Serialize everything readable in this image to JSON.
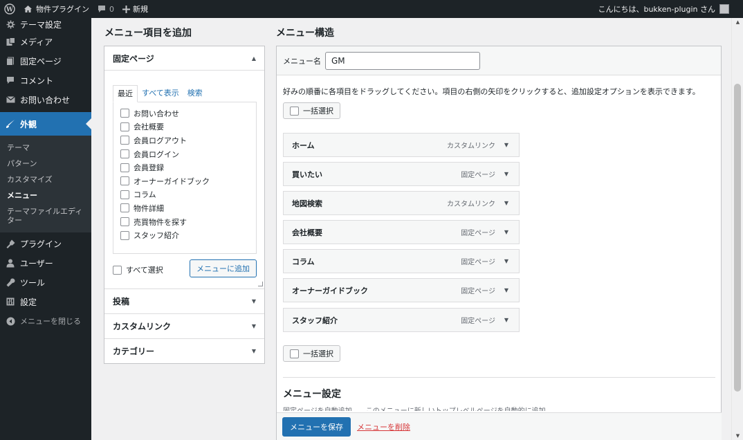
{
  "adminbar": {
    "site_name": "物件プラグイン",
    "comments_count": "0",
    "new_label": "新規",
    "greeting": "こんにちは、bukken-plugin さん"
  },
  "sidebar": {
    "items_top": [
      {
        "label": "テーマ設定",
        "icon": "brush-icon"
      },
      {
        "label": "メディア",
        "icon": "media-icon"
      },
      {
        "label": "固定ページ",
        "icon": "page-icon"
      },
      {
        "label": "コメント",
        "icon": "comment-icon"
      },
      {
        "label": "お問い合わせ",
        "icon": "mail-icon"
      }
    ],
    "current": {
      "label": "外観",
      "icon": "appearance-icon"
    },
    "submenu": [
      "テーマ",
      "パターン",
      "カスタマイズ",
      "メニュー",
      "テーマファイルエディター"
    ],
    "submenu_current": "メニュー",
    "items_bottom": [
      {
        "label": "プラグイン",
        "icon": "plugin-icon"
      },
      {
        "label": "ユーザー",
        "icon": "user-icon"
      },
      {
        "label": "ツール",
        "icon": "tools-icon"
      },
      {
        "label": "設定",
        "icon": "settings-icon"
      }
    ],
    "collapse_label": "メニューを閉じる"
  },
  "add_items": {
    "heading": "メニュー項目を追加",
    "pages_section": {
      "title": "固定ページ",
      "tabs": [
        "最近",
        "すべて表示",
        "検索"
      ],
      "active_tab": "最近",
      "pages": [
        "お問い合わせ",
        "会社概要",
        "会員ログアウト",
        "会員ログイン",
        "会員登録",
        "オーナーガイドブック",
        "コラム",
        "物件詳細",
        "売買物件を探す",
        "スタッフ紹介"
      ],
      "select_all_label": "すべて選択",
      "add_button": "メニューに追加"
    },
    "other_sections": [
      "投稿",
      "カスタムリンク",
      "カテゴリー"
    ]
  },
  "menu_structure": {
    "heading": "メニュー構造",
    "name_label": "メニュー名",
    "name_value": "GM",
    "instructions": "好みの順番に各項目をドラッグしてください。項目の右側の矢印をクリックすると、追加設定オプションを表示できます。",
    "bulk_select_label": "一括選択",
    "items": [
      {
        "title": "ホーム",
        "type": "カスタムリンク"
      },
      {
        "title": "買いたい",
        "type": "固定ページ"
      },
      {
        "title": "地図検索",
        "type": "カスタムリンク"
      },
      {
        "title": "会社概要",
        "type": "固定ページ"
      },
      {
        "title": "コラム",
        "type": "固定ページ"
      },
      {
        "title": "オーナーガイドブック",
        "type": "固定ページ"
      },
      {
        "title": "スタッフ紹介",
        "type": "固定ページ"
      }
    ],
    "settings_heading": "メニュー設定",
    "settings_partial": "固定ページを自動追加　　このメニューに新しいトップレベルページを自動的に追加",
    "save_button": "メニューを保存",
    "delete_link": "メニューを削除"
  },
  "colors": {
    "accent": "#2271b1",
    "sidebar_bg": "#1d2327",
    "delete": "#d63638"
  }
}
